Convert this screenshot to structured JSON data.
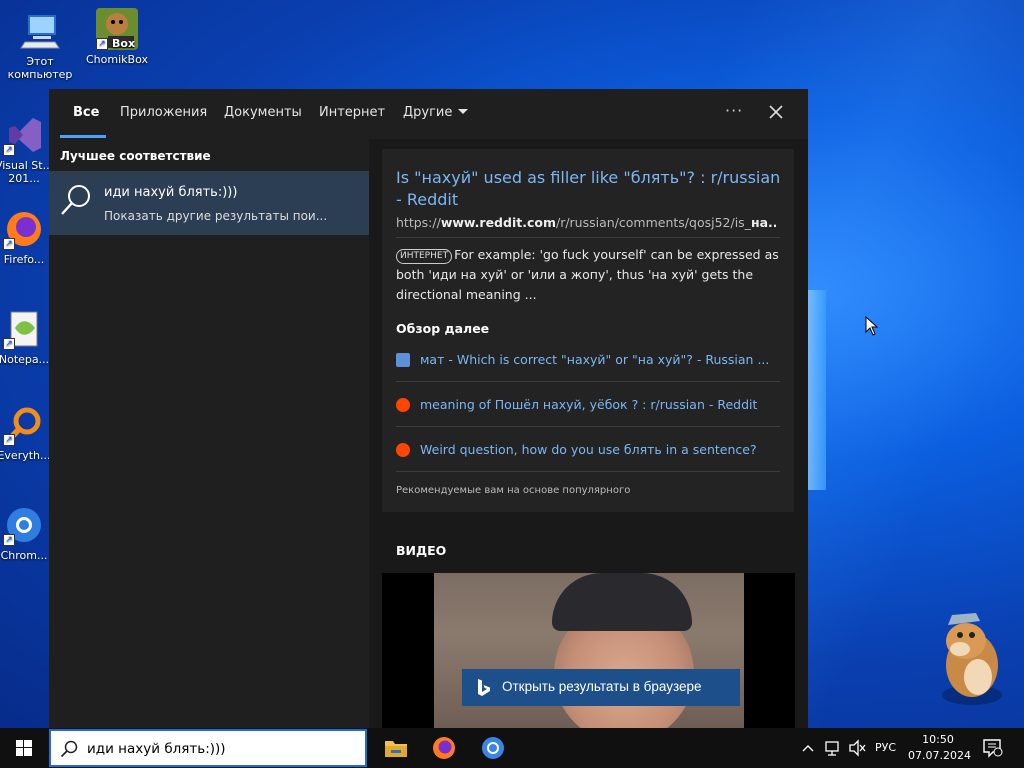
{
  "desktop": {
    "icons": [
      {
        "label": "Этот компьютер"
      },
      {
        "label": "ChomikBox"
      },
      {
        "label": "Visual St... 201..."
      },
      {
        "label": "Firefo..."
      },
      {
        "label": "Notepa..."
      },
      {
        "label": "Everyth..."
      },
      {
        "label": "Chrom..."
      }
    ],
    "chomik_badge": "Box"
  },
  "search_panel": {
    "tabs": [
      {
        "label": "Все",
        "active": true
      },
      {
        "label": "Приложения"
      },
      {
        "label": "Документы"
      },
      {
        "label": "Интернет"
      },
      {
        "label": "Другие"
      }
    ],
    "more_label": "···",
    "best_match": {
      "header": "Лучшее соответствие",
      "title": "иди нахуй блять:)))",
      "subtitle": "Показать другие результаты пои..."
    },
    "result": {
      "title": "Is \"нахуй\" used as filler like \"блять\"? : r/russian - Reddit",
      "url_prefix": "https://",
      "url_domain": "www.reddit.com",
      "url_path": "/r/russian/comments/qosj52/is_",
      "url_bold_tail": "на...",
      "badge": "ИНТЕРНЕТ",
      "snippet": "For example: 'go fuck yourself' can be expressed as both 'иди на хуй' or 'или а жопу', thus 'на хуй' gets the directional meaning ...",
      "explore_header": "Обзор далее",
      "explore_links": [
        {
          "text": "мат - Which is correct \"нахуй\" or \"на хуй\"? - Russian ...",
          "icon": "stackexchange-icon"
        },
        {
          "text": "meaning of Пошёл нахуй, уёбок ? : r/russian - Reddit",
          "icon": "reddit-icon"
        },
        {
          "text": "Weird question, how do you use блять in a sentence?",
          "icon": "reddit-icon"
        }
      ],
      "recommended": "Рекомендуемые вам на основе популярного"
    },
    "video_header": "ВИДЕО",
    "open_browser_label": "Открыть результаты в браузере"
  },
  "taskbar": {
    "search_value": "иди нахуй блять:)))",
    "language": "РУС",
    "time": "10:50",
    "date": "07.07.2024"
  },
  "colors": {
    "accent": "#4aa3ff",
    "link": "#7cb6f4",
    "selection": "#2b3e54",
    "browser_button": "#1d4f8a"
  }
}
